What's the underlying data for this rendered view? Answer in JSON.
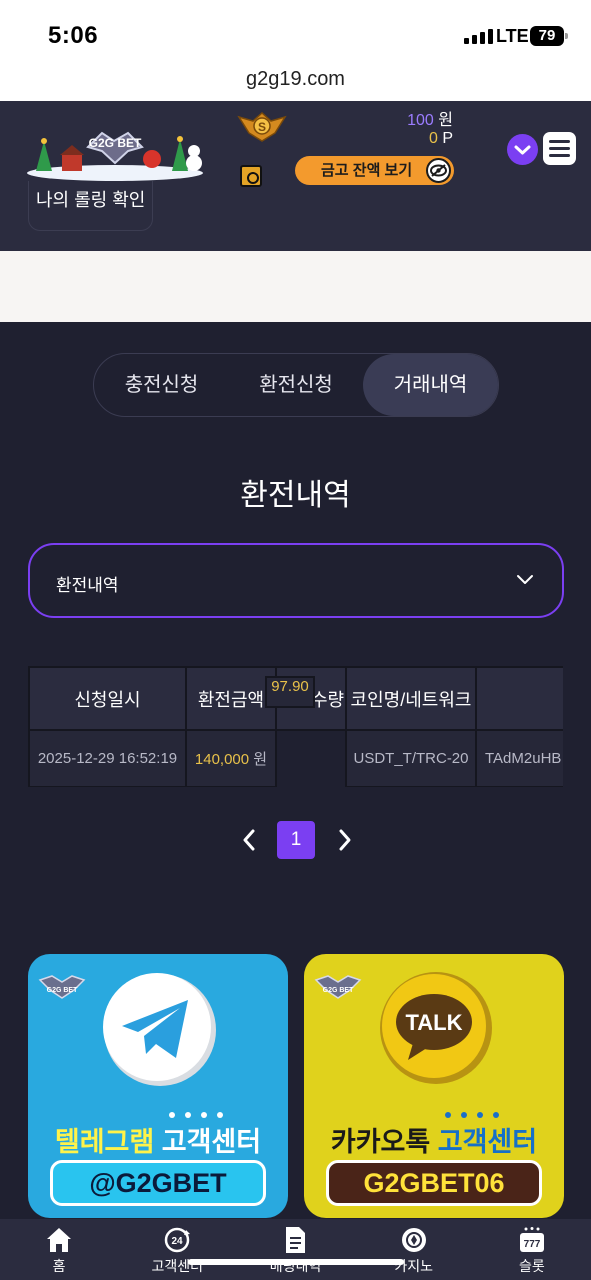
{
  "status_bar": {
    "time": "5:06",
    "network": "LTE",
    "battery": "79"
  },
  "browser": {
    "url": "g2g19.com"
  },
  "header": {
    "logo_text": "G2G BET",
    "balance_amount": "100",
    "balance_unit": "원",
    "points_amount": "0",
    "points_unit": "P",
    "vault_button": "금고 잔액 보기",
    "rolling_button": "나의 롤링 확인"
  },
  "tabs": [
    "충전신청",
    "환전신청",
    "거래내역"
  ],
  "active_tab": "거래내역",
  "section_title": "환전내역",
  "select": {
    "value": "환전내역"
  },
  "table": {
    "headers": [
      "신청일시",
      "환전금액",
      "코인수량",
      "코인명/네트워크",
      ""
    ],
    "rows": [
      {
        "date": "2025-12-29 16:52:19",
        "amount": "140,000",
        "amount_unit": "원",
        "coin_qty": "97.90",
        "network": "USDT_T/TRC-20",
        "address": "TAdM2uHB"
      }
    ]
  },
  "pagination": {
    "current_page": "1"
  },
  "support_cards": [
    {
      "service": "텔레그램",
      "suffix": "고객센터",
      "handle": "@G2GBET",
      "logo_text": "G2G BET"
    },
    {
      "service": "카카오톡",
      "suffix": "고객센터",
      "handle": "G2GBET06",
      "logo_text": "G2G BET",
      "bubble_text": "TALK"
    }
  ],
  "bottom_nav": [
    {
      "label": "홈",
      "icon": "home-icon"
    },
    {
      "label": "고객센터",
      "icon": "support-24h-icon"
    },
    {
      "label": "배팅내역",
      "icon": "document-icon"
    },
    {
      "label": "카지노",
      "icon": "casino-chip-icon"
    },
    {
      "label": "슬롯",
      "icon": "slot-777-icon"
    }
  ],
  "colors": {
    "accent": "#7b3ff2",
    "gold": "#e8c14a",
    "background": "#1f2030",
    "header": "#2b2c3f",
    "vault_button": "#f39a2d"
  }
}
